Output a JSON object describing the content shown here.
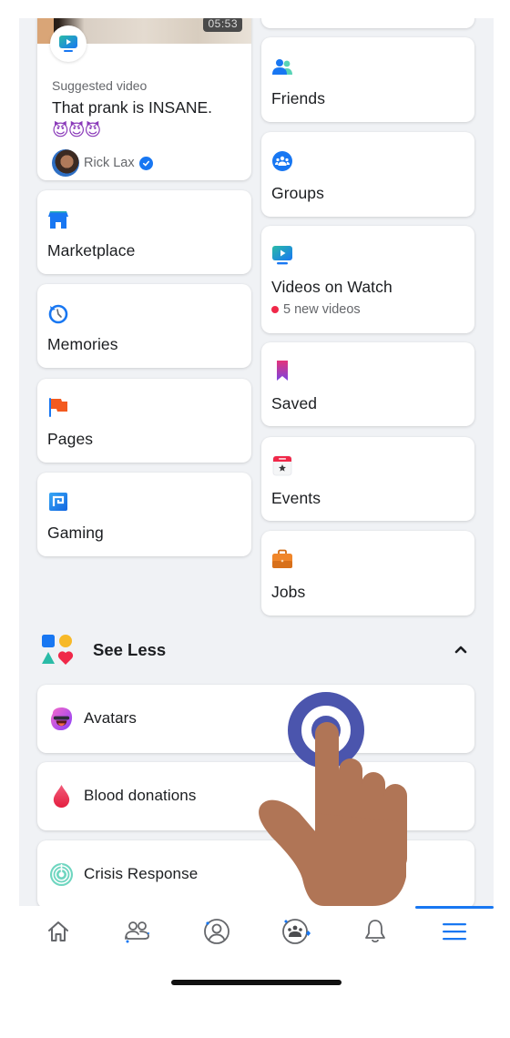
{
  "suggested_video": {
    "duration": "05:53",
    "label": "Suggested video",
    "title": "That prank is INSANE.",
    "emoji": "😈😈😈",
    "author": "Rick Lax",
    "author_verified": true
  },
  "shortcuts_left": [
    {
      "id": "marketplace",
      "label": "Marketplace",
      "icon": "marketplace-icon"
    },
    {
      "id": "memories",
      "label": "Memories",
      "icon": "memories-icon"
    },
    {
      "id": "pages",
      "label": "Pages",
      "icon": "pages-icon"
    },
    {
      "id": "gaming",
      "label": "Gaming",
      "icon": "gaming-icon"
    }
  ],
  "shortcuts_right": [
    {
      "id": "friends",
      "label": "Friends",
      "icon": "friends-icon"
    },
    {
      "id": "groups",
      "label": "Groups",
      "icon": "groups-icon"
    },
    {
      "id": "videos-on-watch",
      "label": "Videos on Watch",
      "icon": "watch-icon",
      "sublabel": "5 new videos"
    },
    {
      "id": "saved",
      "label": "Saved",
      "icon": "saved-icon"
    },
    {
      "id": "events",
      "label": "Events",
      "icon": "events-icon"
    },
    {
      "id": "jobs",
      "label": "Jobs",
      "icon": "jobs-icon"
    }
  ],
  "see_less": {
    "label": "See Less",
    "expanded": true
  },
  "more_items": [
    {
      "id": "avatars",
      "label": "Avatars",
      "icon": "avatars-icon"
    },
    {
      "id": "blood-donations",
      "label": "Blood donations",
      "icon": "blood-drop-icon"
    },
    {
      "id": "crisis-response",
      "label": "Crisis Response",
      "icon": "crisis-response-icon"
    }
  ],
  "bottom_nav": {
    "tabs": [
      {
        "id": "home",
        "icon": "home-icon",
        "active": false
      },
      {
        "id": "friends",
        "icon": "friends-outline-icon",
        "active": false
      },
      {
        "id": "profile",
        "icon": "profile-icon",
        "active": false
      },
      {
        "id": "groups",
        "icon": "groups-outline-icon",
        "active": false
      },
      {
        "id": "notifications",
        "icon": "bell-icon",
        "active": false
      },
      {
        "id": "menu",
        "icon": "menu-icon",
        "active": true
      }
    ]
  },
  "colors": {
    "accent": "#1877f2",
    "background": "#f0f2f5",
    "new_dot": "#f02849",
    "tap_indicator": "#4b55ad",
    "hand": "#b07556"
  },
  "overlay": {
    "gesture": "tap",
    "target": "avatars"
  }
}
